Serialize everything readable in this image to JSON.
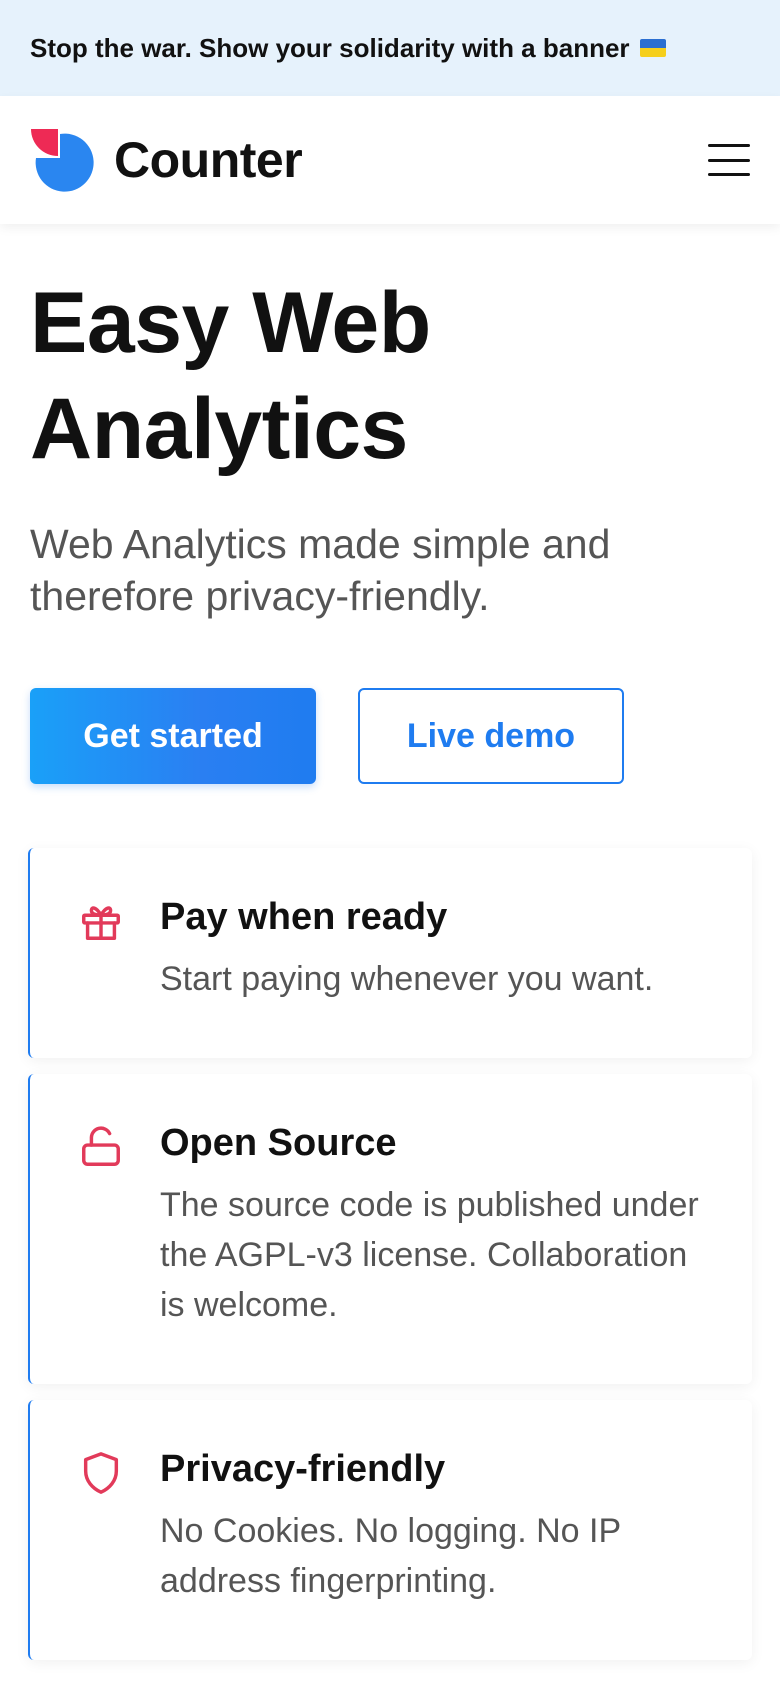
{
  "banner": {
    "text": "Stop the war. Show your solidarity with a banner",
    "flag_icon": "ukraine-flag-icon"
  },
  "header": {
    "brand_name": "Counter",
    "logo_icon": "counter-logo-icon",
    "menu_icon": "hamburger-menu-icon",
    "colors": {
      "logo_blue": "#2a86f0",
      "logo_red": "#ee2a55"
    }
  },
  "hero": {
    "title_line1": "Easy Web",
    "title_line2": "Analytics",
    "subtitle": "Web Analytics made simple and therefore privacy-friendly."
  },
  "buttons": {
    "primary_label": "Get started",
    "secondary_label": "Live demo"
  },
  "features": [
    {
      "icon": "gift-icon",
      "title": "Pay when ready",
      "text": "Start paying whenever you want."
    },
    {
      "icon": "unlock-icon",
      "title": "Open Source",
      "text": "The source code is published under the AGPL-v3 license. Collaboration is welcome."
    },
    {
      "icon": "shield-icon",
      "title": "Privacy-friendly",
      "text": "No Cookies. No logging. No IP address fingerprinting."
    }
  ],
  "theme": {
    "accent": "#1f7cf0",
    "icon_red": "#e23a5a",
    "banner_bg": "#e6f2fc"
  }
}
